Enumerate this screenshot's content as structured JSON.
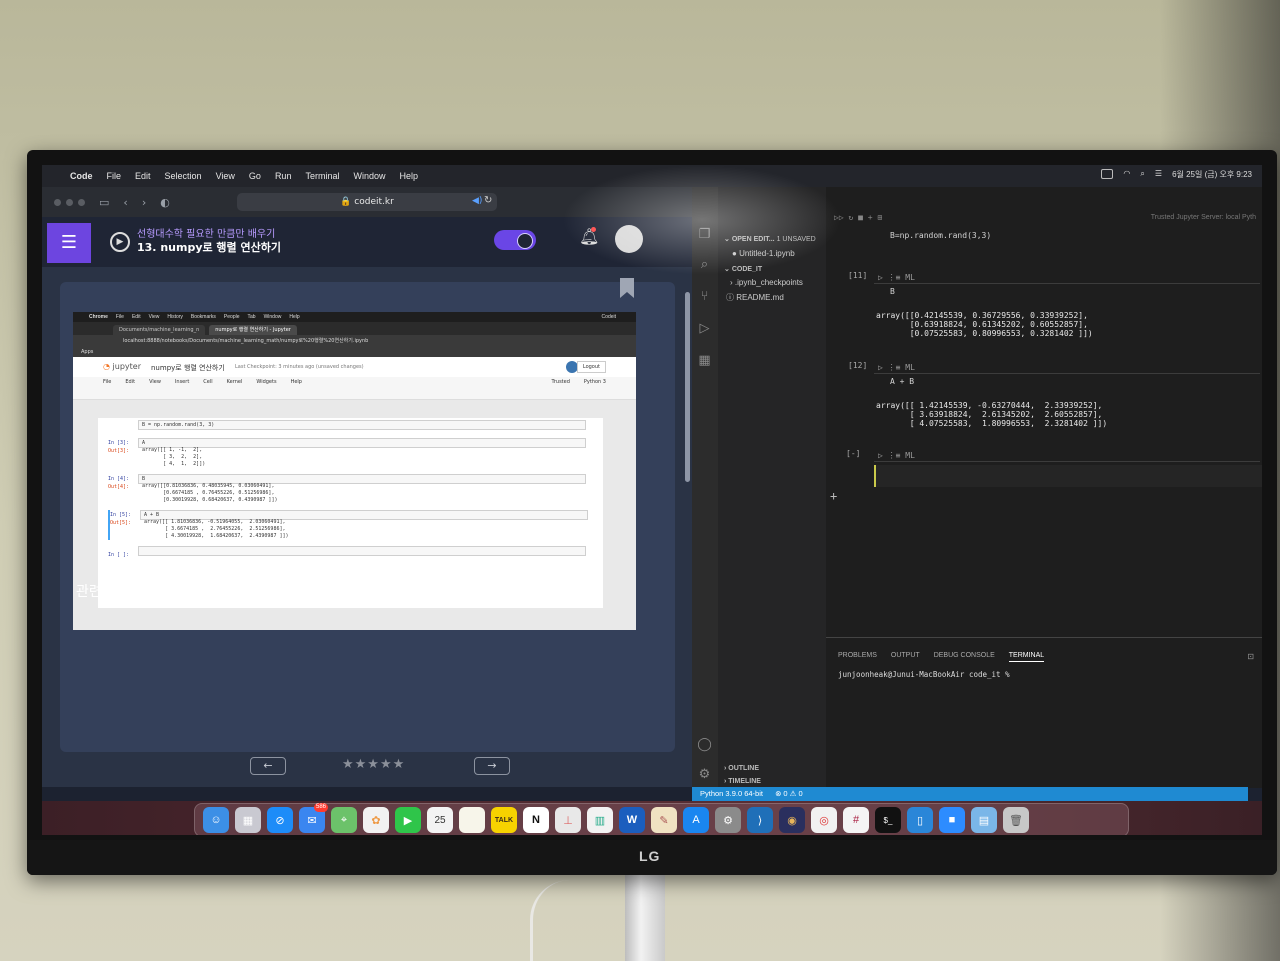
{
  "monitor": {
    "brand": "LG"
  },
  "menubar": {
    "app": "Code",
    "items": [
      "File",
      "Edit",
      "Selection",
      "View",
      "Go",
      "Run",
      "Terminal",
      "Window",
      "Help"
    ],
    "clock": "6월 25일 (금) 오후 9:23"
  },
  "safari": {
    "url": "codeit.kr"
  },
  "codeit": {
    "course_title": "선형대수학 필요한 만큼만 배우기",
    "lesson_title": "13. numpy로 행렬 연산하기",
    "related_label": "관련 질문",
    "prev_icon": "←",
    "next_icon": "→",
    "rating_stars": "★★★★★"
  },
  "inner_screenshot": {
    "menubar": [
      "Chrome",
      "File",
      "Edit",
      "View",
      "History",
      "Bookmarks",
      "People",
      "Tab",
      "Window",
      "Help"
    ],
    "menubar_right": "Codeit",
    "tabs": [
      "Documents/machine_learning_n",
      "numpy로 행렬 연산하기 - Jupyter"
    ],
    "address": "localhost:8888/notebooks/Documents/machine_learning_math/numpy로%20행렬%20연산하기.ipynb",
    "apps_label": "Apps",
    "jupyter_logo": "jupyter",
    "notebook_name": "numpy로 행렬 연산하기",
    "checkpoint": "Last Checkpoint: 3 minutes ago  (unsaved changes)",
    "logout": "Logout",
    "menu": [
      "File",
      "Edit",
      "View",
      "Insert",
      "Cell",
      "Kernel",
      "Widgets",
      "Help"
    ],
    "trusted": "Trusted",
    "kernel": "Python 3",
    "cell0_code": "B = np.random.rand(3, 3)",
    "in3_prompt": "In [3]:",
    "in3_code": "A",
    "out3_prompt": "Out[3]:",
    "out3_text": "array([[ 1, -1,  2],\n       [ 3,  2,  2],\n       [ 4,  1,  2]])",
    "in4_prompt": "In [4]:",
    "in4_code": "B",
    "out4_prompt": "Out[4]:",
    "out4_text": "array([[0.81036836, 0.48035945, 0.03060491],\n       [0.6674185 , 0.76455226, 0.51256986],\n       [0.30019928, 0.68420637, 0.4390987 ]])",
    "in5_prompt": "In [5]:",
    "in5_code": "A + B",
    "out5_prompt": "Out[5]:",
    "out5_text": "array([[ 1.81036836, -0.51964055,  2.03060491],\n       [ 3.6674185 ,  2.76455226,  2.51256986],\n       [ 4.30019928,  1.68420637,  2.4390987 ]])",
    "in_empty_prompt": "In [ ]:"
  },
  "vscode": {
    "open_editors_label": "OPEN EDIT...",
    "unsaved_label": "1 UNSAVED",
    "open_file": "Untitled-1.ipynb",
    "folder": "CODE_IT",
    "files": [
      ".ipynb_checkpoints",
      "README.md"
    ],
    "outline": "OUTLINE",
    "timeline": "TIMELINE",
    "trusted": "Trusted",
    "jupyter_server": "Jupyter Server: local",
    "kernel_short": "Pyth",
    "top_code": "B=np.random.rand(3,3)",
    "cells": [
      {
        "num": "[11]",
        "lang": "ML",
        "code": "B",
        "output": "array([[0.42145539, 0.36729556, 0.33939252],\n       [0.63918824, 0.61345202, 0.60552857],\n       [0.07525583, 0.80996553, 0.3281402 ]])"
      },
      {
        "num": "[12]",
        "lang": "ML",
        "code": "A + B",
        "output": "array([[ 1.42145539, -0.63270444,  2.33939252],\n       [ 3.63918824,  2.61345202,  2.60552857],\n       [ 4.07525583,  1.80996553,  2.3281402 ]])"
      },
      {
        "num": "[-]",
        "lang": "ML",
        "code": "",
        "output": ""
      }
    ],
    "panel_tabs": [
      "PROBLEMS",
      "OUTPUT",
      "DEBUG CONSOLE",
      "TERMINAL"
    ],
    "terminal_prompt": "junjoonheak@Junui-MacBookAir code_it %",
    "status_python": "Python 3.9.0 64-bit",
    "status_problems": "⊗ 0 ⚠ 0"
  },
  "dock": {
    "calendar_day": "25",
    "mail_badge": "586",
    "kakao_label": "TALK",
    "notion_label": "N",
    "word_label": "W"
  },
  "colors": {
    "codeit_purple": "#6d45e0",
    "vscode_status": "#1f8ad2",
    "jupyter_orange": "#f37626"
  }
}
